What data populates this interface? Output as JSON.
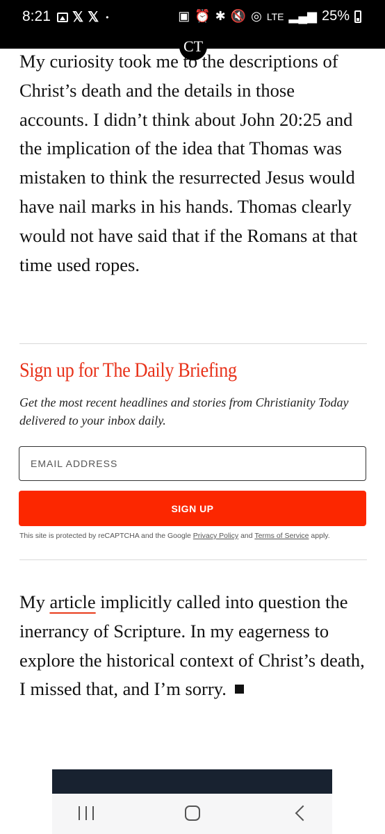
{
  "status_bar": {
    "time": "8:21",
    "left_icons": [
      "gallery-icon",
      "x-icon",
      "x-icon",
      "dot"
    ],
    "x_glyph": "𝕏",
    "dot_glyph": "•",
    "lte": "LTE",
    "battery_percent": "25%"
  },
  "site": {
    "logo": "CT"
  },
  "article": {
    "paragraph1": "My curiosity took me to the descriptions of Christ’s death and the details in those accounts. I didn’t think about John 20:25 and the implication of the idea that Thomas was mistaken to think the resurrected Jesus would have nail marks in his hands. Thomas clearly would not have said that if the Romans at that time used ropes.",
    "paragraph2_before": "My ",
    "paragraph2_link": "article",
    "paragraph2_after": " implicitly called into question the inerrancy of Scripture. In my eagerness to explore the historical context of Christ’s death, I missed that, and I’m sorry."
  },
  "newsletter": {
    "title": "Sign up for The Daily Briefing",
    "description": "Get the most recent headlines and stories from Christianity Today delivered to your inbox daily.",
    "email_placeholder": "EMAIL ADDRESS",
    "button_label": "SIGN UP",
    "legal_prefix": "This site is protected by reCAPTCHA and the Google ",
    "privacy_link": "Privacy Policy",
    "legal_and": " and ",
    "terms_link": "Terms of Service",
    "legal_suffix": " apply."
  },
  "colors": {
    "accent": "#fc2700",
    "title_red": "#e8321a",
    "dark_block": "#182230"
  }
}
